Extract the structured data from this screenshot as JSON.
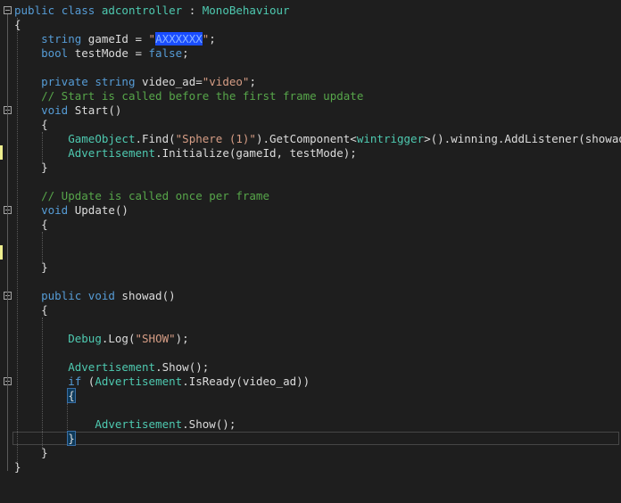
{
  "lines": [
    [
      [
        "kw",
        "public"
      ],
      [
        "plain",
        " "
      ],
      [
        "kw",
        "class"
      ],
      [
        "plain",
        " "
      ],
      [
        "type",
        "adcontroller"
      ],
      [
        "plain",
        " : "
      ],
      [
        "type",
        "MonoBehaviour"
      ]
    ],
    [
      [
        "plain",
        "{"
      ]
    ],
    [
      [
        "plain",
        "    "
      ],
      [
        "kw",
        "string"
      ],
      [
        "plain",
        " gameId = "
      ],
      [
        "str",
        "\""
      ],
      [
        "redact",
        "AXXXXXX"
      ],
      [
        "str",
        "\""
      ],
      [
        "plain",
        ";"
      ]
    ],
    [
      [
        "plain",
        "    "
      ],
      [
        "kw",
        "bool"
      ],
      [
        "plain",
        " testMode = "
      ],
      [
        "kw",
        "false"
      ],
      [
        "plain",
        ";"
      ]
    ],
    [
      [
        "plain",
        ""
      ]
    ],
    [
      [
        "plain",
        "    "
      ],
      [
        "kw",
        "private"
      ],
      [
        "plain",
        " "
      ],
      [
        "kw",
        "string"
      ],
      [
        "plain",
        " video_ad="
      ],
      [
        "str",
        "\"video\""
      ],
      [
        "plain",
        ";"
      ]
    ],
    [
      [
        "plain",
        "    "
      ],
      [
        "cmt",
        "// Start is called before the first frame update"
      ]
    ],
    [
      [
        "plain",
        "    "
      ],
      [
        "kw",
        "void"
      ],
      [
        "plain",
        " Start()"
      ]
    ],
    [
      [
        "plain",
        "    {"
      ]
    ],
    [
      [
        "plain",
        "        "
      ],
      [
        "type",
        "GameObject"
      ],
      [
        "plain",
        ".Find("
      ],
      [
        "str",
        "\"Sphere (1)\""
      ],
      [
        "plain",
        ").GetComponent<"
      ],
      [
        "type",
        "wintrigger"
      ],
      [
        "plain",
        ">().winning.AddListener(showad);"
      ]
    ],
    [
      [
        "plain",
        "        "
      ],
      [
        "type",
        "Advertisement"
      ],
      [
        "plain",
        ".Initialize(gameId, testMode);"
      ]
    ],
    [
      [
        "plain",
        "    }"
      ]
    ],
    [
      [
        "plain",
        ""
      ]
    ],
    [
      [
        "plain",
        "    "
      ],
      [
        "cmt",
        "// Update is called once per frame"
      ]
    ],
    [
      [
        "plain",
        "    "
      ],
      [
        "kw",
        "void"
      ],
      [
        "plain",
        " Update()"
      ]
    ],
    [
      [
        "plain",
        "    {"
      ]
    ],
    [
      [
        "plain",
        ""
      ]
    ],
    [
      [
        "plain",
        ""
      ]
    ],
    [
      [
        "plain",
        "    }"
      ]
    ],
    [
      [
        "plain",
        ""
      ]
    ],
    [
      [
        "plain",
        "    "
      ],
      [
        "kw",
        "public"
      ],
      [
        "plain",
        " "
      ],
      [
        "kw",
        "void"
      ],
      [
        "plain",
        " showad()"
      ]
    ],
    [
      [
        "plain",
        "    {"
      ]
    ],
    [
      [
        "plain",
        ""
      ]
    ],
    [
      [
        "plain",
        "        "
      ],
      [
        "type",
        "Debug"
      ],
      [
        "plain",
        ".Log("
      ],
      [
        "str",
        "\"SHOW\""
      ],
      [
        "plain",
        ");"
      ]
    ],
    [
      [
        "plain",
        ""
      ]
    ],
    [
      [
        "plain",
        "        "
      ],
      [
        "type",
        "Advertisement"
      ],
      [
        "plain",
        ".Show();"
      ]
    ],
    [
      [
        "plain",
        "        "
      ],
      [
        "kw",
        "if"
      ],
      [
        "plain",
        " ("
      ],
      [
        "type",
        "Advertisement"
      ],
      [
        "plain",
        ".IsReady(video_ad))"
      ]
    ],
    [
      [
        "plain",
        "        "
      ],
      [
        "brace",
        "{"
      ]
    ],
    [
      [
        "plain",
        ""
      ]
    ],
    [
      [
        "plain",
        "            "
      ],
      [
        "type",
        "Advertisement"
      ],
      [
        "plain",
        ".Show();"
      ]
    ],
    [
      [
        "plain",
        "        "
      ],
      [
        "brace",
        "}"
      ]
    ],
    [
      [
        "plain",
        "    }"
      ]
    ],
    [
      [
        "plain",
        "}"
      ]
    ]
  ],
  "colors": {
    "background": "#1e1e1e",
    "keyword": "#569cd6",
    "type": "#4ec9b0",
    "string": "#d69d85",
    "comment": "#57a64a",
    "text": "#dcdcdc",
    "change_marker": "#efef8f"
  },
  "fold_markers": [
    "collapse-icon",
    "collapse-icon",
    "collapse-icon",
    "collapse-icon",
    "collapse-icon"
  ],
  "change_markers": [
    "modified-line-marker",
    "modified-line-marker"
  ]
}
